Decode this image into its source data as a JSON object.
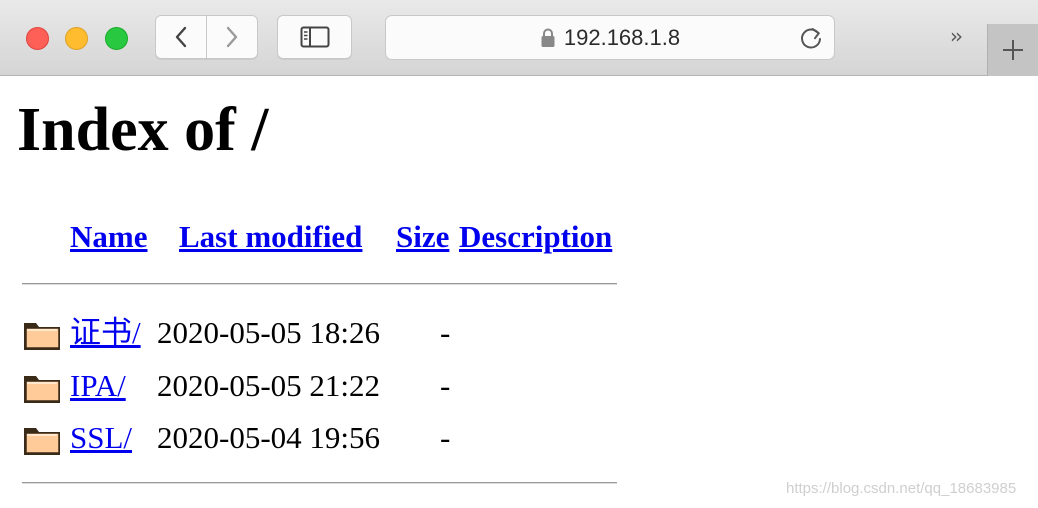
{
  "browser": {
    "address": "192.168.1.8"
  },
  "page": {
    "title": "Index of /",
    "columns": {
      "name": "Name",
      "last_modified": "Last modified",
      "size": "Size",
      "description": "Description"
    },
    "entries": [
      {
        "name": "证书/",
        "modified": "2020-05-05 18:26",
        "size": "-",
        "icon": "folder-icon"
      },
      {
        "name": "IPA/",
        "modified": "2020-05-05 21:22",
        "size": "-",
        "icon": "folder-icon"
      },
      {
        "name": "SSL/",
        "modified": "2020-05-04 19:56",
        "size": "-",
        "icon": "folder-icon"
      }
    ]
  },
  "watermark": "https://blog.csdn.net/qq_18683985",
  "colors": {
    "link": "#0000ee",
    "folder": "#ffcc99"
  }
}
